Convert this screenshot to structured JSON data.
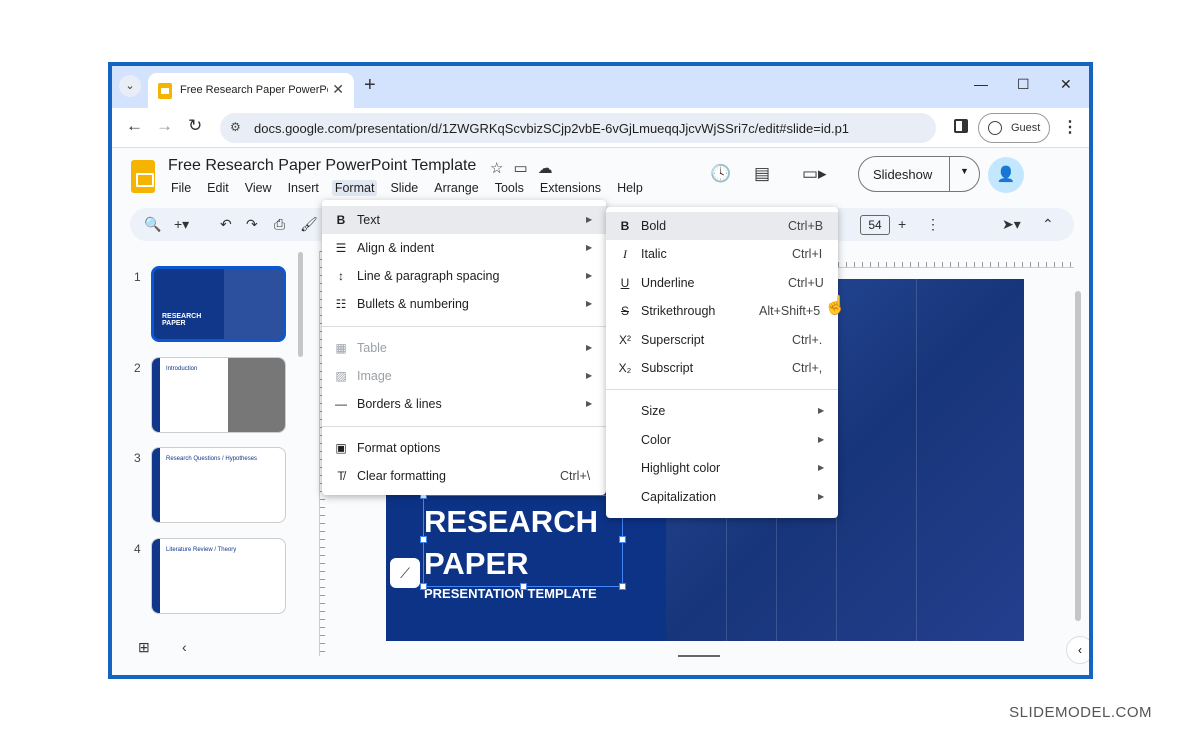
{
  "browser": {
    "tab_title": "Free Research Paper PowerPoint Template",
    "url": "docs.google.com/presentation/d/1ZWGRKqScvbizSCjp2vbE-6vGjLmueqqJjcvWjSSri7c/edit#slide=id.p1",
    "profile_label": "Guest"
  },
  "app": {
    "doc_title": "Free Research Paper PowerPoint Template",
    "menus": [
      "File",
      "Edit",
      "View",
      "Insert",
      "Format",
      "Slide",
      "Arrange",
      "Tools",
      "Extensions",
      "Help"
    ],
    "slideshow_label": "Slideshow",
    "font_size": "54"
  },
  "filmstrip": {
    "numbers": [
      "1",
      "2",
      "3",
      "4"
    ],
    "thumb2_title": "Introduction",
    "thumb3_title": "Research Questions / Hypotheses",
    "thumb4_title": "Literature Review / Theory",
    "thumb1_title": "RESEARCH PAPER"
  },
  "slide": {
    "title_line1": "RESEARCH",
    "title_line2": "PAPER",
    "subtitle": "PRESENTATION TEMPLATE"
  },
  "format_menu": {
    "text": "Text",
    "align": "Align & indent",
    "spacing": "Line & paragraph spacing",
    "bullets": "Bullets & numbering",
    "table": "Table",
    "image": "Image",
    "borders": "Borders & lines",
    "options": "Format options",
    "clear": "Clear formatting",
    "clear_shortcut": "Ctrl+\\"
  },
  "text_submenu": {
    "bold": "Bold",
    "bold_sc": "Ctrl+B",
    "italic": "Italic",
    "italic_sc": "Ctrl+I",
    "underline": "Underline",
    "underline_sc": "Ctrl+U",
    "strike": "Strikethrough",
    "strike_sc": "Alt+Shift+5",
    "sup": "Superscript",
    "sup_sc": "Ctrl+.",
    "sub": "Subscript",
    "sub_sc": "Ctrl+,",
    "size": "Size",
    "color": "Color",
    "highlight": "Highlight color",
    "caps": "Capitalization"
  },
  "watermark": "SLIDEMODEL.COM",
  "colors": {
    "accent": "#0b57d0",
    "frame": "#1565c0",
    "slide_bg": "#0d3387"
  }
}
